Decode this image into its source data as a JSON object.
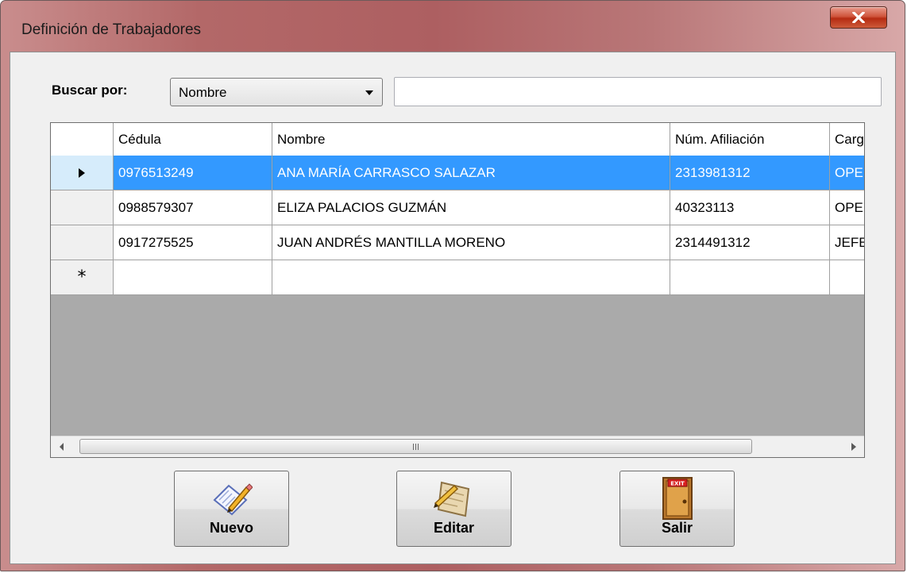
{
  "window": {
    "title": "Definición de Trabajadores"
  },
  "search": {
    "label": "Buscar por:",
    "field_selected": "Nombre",
    "query": "",
    "placeholder": ""
  },
  "grid": {
    "columns": [
      "Cédula",
      "Nombre",
      "Núm. Afiliación",
      "Cargo"
    ],
    "rows": [
      {
        "cedula": "0976513249",
        "nombre": "ANA MARÍA CARRASCO SALAZAR",
        "afiliacion": "2313981312",
        "cargo": "OPER"
      },
      {
        "cedula": "0988579307",
        "nombre": "ELIZA PALACIOS GUZMÁN",
        "afiliacion": "40323113",
        "cargo": "OPER"
      },
      {
        "cedula": "0917275525",
        "nombre": "JUAN ANDRÉS MANTILLA MORENO",
        "afiliacion": "2314491312",
        "cargo": "JEFE"
      }
    ],
    "selected_row_index": 0,
    "new_row_marker": "*"
  },
  "buttons": {
    "nuevo": "Nuevo",
    "editar": "Editar",
    "salir": "Salir"
  },
  "colors": {
    "selection": "#3399ff",
    "grid_background": "#aaaaaa",
    "close_button": "#c6401f"
  },
  "icons": {
    "selected_row": "row-pointer-icon",
    "new_row": "asterisk-icon",
    "nuevo": "new-document-pencil-icon",
    "editar": "edit-pencil-paper-icon",
    "salir": "exit-door-icon"
  }
}
